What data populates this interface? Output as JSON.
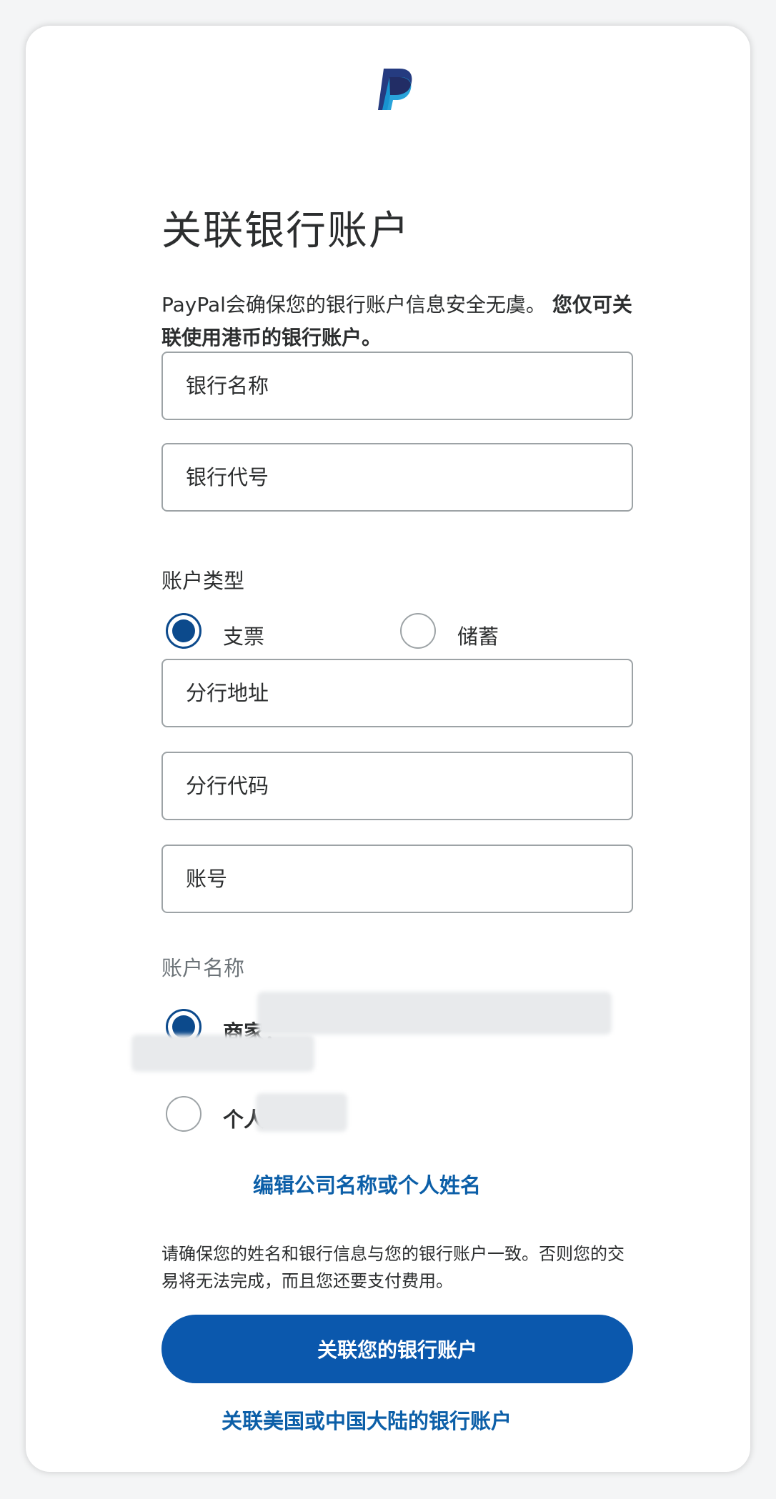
{
  "header": {
    "logo_icon": "paypal-logo-icon",
    "title": "关联银行账户"
  },
  "intro": {
    "text_regular": "PayPal会确保您的银行账户信息安全无虞。",
    "text_bold": "您仅可关联使用港币的银行账户。"
  },
  "form": {
    "bank_name_placeholder": "银行名称",
    "bank_code_placeholder": "银行代号",
    "account_type_label": "账户类型",
    "account_type_options": [
      {
        "label": "支票",
        "selected": true
      },
      {
        "label": "储蓄",
        "selected": false
      }
    ],
    "branch_address_placeholder": "分行地址",
    "branch_code_placeholder": "分行代码",
    "account_number_placeholder": "账号",
    "account_name_label": "账户名称",
    "account_name_options": [
      {
        "label": "商家：",
        "selected": true
      },
      {
        "label": "个人：",
        "selected": false
      }
    ],
    "edit_name_link": "编辑公司名称或个人姓名"
  },
  "notice": "请确保您的姓名和银行信息与您的银行账户一致。否则您的交易将无法完成，而且您还要支付费用。",
  "actions": {
    "primary_button": "关联您的银行账户",
    "secondary_link": "关联美国或中国大陆的银行账户"
  },
  "colors": {
    "primary": "#0b58ad",
    "radio_selected": "#0c4a8c",
    "link": "#0c5fa8",
    "paypal_dark": "#253b80",
    "paypal_light": "#179bd7"
  }
}
